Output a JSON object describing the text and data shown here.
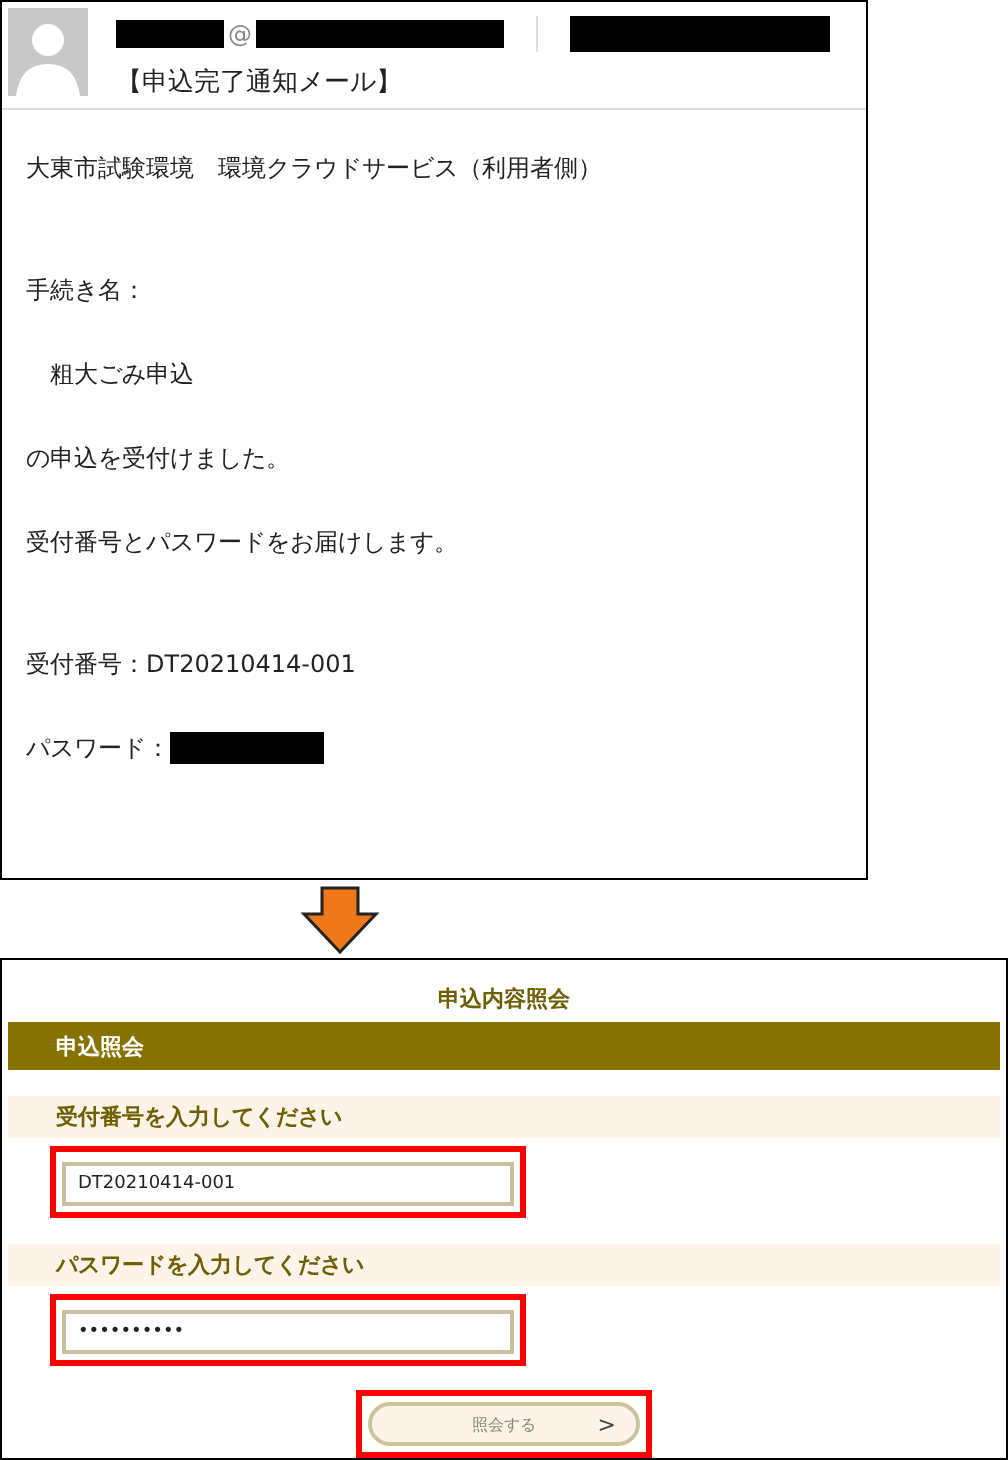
{
  "email": {
    "at_sign": "@",
    "subject": "【申込完了通知メール】",
    "body": [
      [
        "大東市試験環境　環境クラウドサービス（利用者側）"
      ],
      [
        "手続き名：",
        "　粗大ごみ申込",
        "の申込を受付けました。",
        "受付番号とパスワードをお届けします。"
      ],
      [
        "受付番号：DT20210414-001"
      ]
    ],
    "password_label": "パスワード："
  },
  "inquiry": {
    "title": "申込内容照会",
    "section": "申込照会",
    "fields": [
      {
        "label": "受付番号を入力してください",
        "value": "DT20210414-001",
        "highlighted": true
      },
      {
        "label": "パスワードを入力してください",
        "value": "••••••••••",
        "highlighted": true
      }
    ],
    "button": {
      "label": "照会する",
      "chevron": ">",
      "highlighted": true
    }
  }
}
